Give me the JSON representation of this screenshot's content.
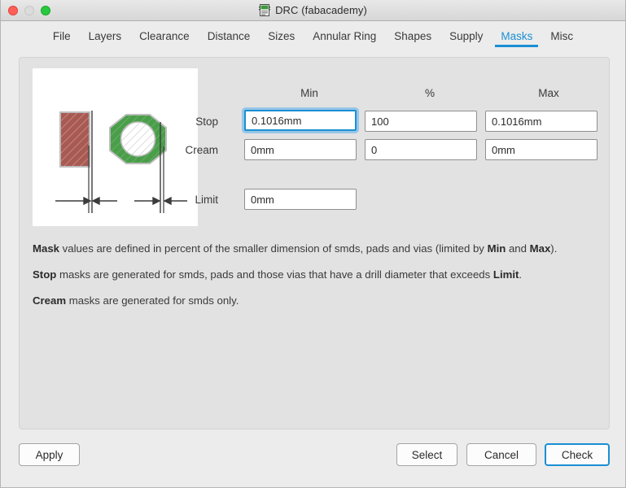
{
  "window": {
    "title": "DRC (fabacademy)",
    "app_icon": "drc-chip-icon",
    "controls": {
      "close": "close-button",
      "minimize": "minimize-button",
      "zoom": "zoom-button"
    }
  },
  "tabs": [
    {
      "label": "File",
      "active": false
    },
    {
      "label": "Layers",
      "active": false
    },
    {
      "label": "Clearance",
      "active": false
    },
    {
      "label": "Distance",
      "active": false
    },
    {
      "label": "Sizes",
      "active": false
    },
    {
      "label": "Annular Ring",
      "active": false
    },
    {
      "label": "Shapes",
      "active": false
    },
    {
      "label": "Supply",
      "active": false
    },
    {
      "label": "Masks",
      "active": true
    },
    {
      "label": "Misc",
      "active": false
    }
  ],
  "illustration": {
    "name": "mask-clearance-diagram",
    "smd_pad_color": "#a85a52",
    "via_pad_color": "#4a9e4a",
    "background": "#ffffff"
  },
  "form": {
    "columns": [
      "Min",
      "%",
      "Max"
    ],
    "rows": [
      {
        "label": "Stop",
        "min": "0.1016mm",
        "percent": "100",
        "max": "0.1016mm",
        "focused_field": "min"
      },
      {
        "label": "Cream",
        "min": "0mm",
        "percent": "0",
        "max": "0mm",
        "focused_field": ""
      }
    ],
    "limit": {
      "label": "Limit",
      "value": "0mm"
    }
  },
  "notes": [
    {
      "parts": [
        {
          "text": "Mask",
          "bold": true
        },
        {
          "text": " values are defined in percent of the smaller dimension of smds, pads and vias (limited by ",
          "bold": false
        },
        {
          "text": "Min",
          "bold": true
        },
        {
          "text": " and ",
          "bold": false
        },
        {
          "text": "Max",
          "bold": true
        },
        {
          "text": ").",
          "bold": false
        }
      ]
    },
    {
      "parts": [
        {
          "text": "Stop",
          "bold": true
        },
        {
          "text": " masks are generated for smds, pads and those vias that have a drill diameter that exceeds ",
          "bold": false
        },
        {
          "text": "Limit",
          "bold": true
        },
        {
          "text": ".",
          "bold": false
        }
      ]
    },
    {
      "parts": [
        {
          "text": "Cream",
          "bold": true
        },
        {
          "text": " masks are generated for smds only.",
          "bold": false
        }
      ]
    }
  ],
  "buttons": {
    "apply": "Apply",
    "select": "Select",
    "cancel": "Cancel",
    "check": "Check"
  },
  "colors": {
    "accent": "#1a8fd4",
    "window_bg": "#ececec",
    "panel_bg": "#e2e2e2",
    "field_bg": "#ffffff",
    "text": "#3a3a3a"
  }
}
